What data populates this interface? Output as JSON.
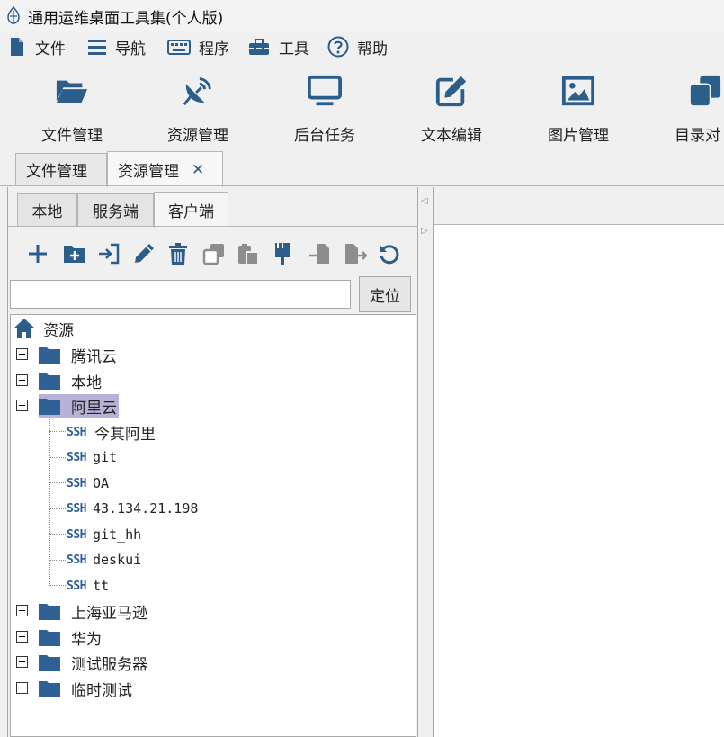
{
  "window": {
    "title": "通用运维桌面工具集(个人版)"
  },
  "menu": [
    {
      "label": "文件",
      "icon": "file-icon"
    },
    {
      "label": "导航",
      "icon": "menu-icon"
    },
    {
      "label": "程序",
      "icon": "keyboard-icon"
    },
    {
      "label": "工具",
      "icon": "toolbox-icon"
    },
    {
      "label": "帮助",
      "icon": "help-icon"
    }
  ],
  "toolbar": [
    {
      "label": "文件管理",
      "icon": "folder-open-icon"
    },
    {
      "label": "资源管理",
      "icon": "satellite-dish-icon"
    },
    {
      "label": "后台任务",
      "icon": "monitor-icon"
    },
    {
      "label": "文本编辑",
      "icon": "edit-icon"
    },
    {
      "label": "图片管理",
      "icon": "image-icon"
    },
    {
      "label": "目录对",
      "icon": "copy-icon"
    }
  ],
  "main_tabs": [
    {
      "label": "文件管理",
      "active": false
    },
    {
      "label": "资源管理",
      "active": true,
      "closable": true
    }
  ],
  "close_glyph": "✕",
  "sub_tabs": [
    {
      "label": "本地",
      "active": false
    },
    {
      "label": "服务端",
      "active": false
    },
    {
      "label": "客户端",
      "active": true
    }
  ],
  "actions": [
    "add-icon",
    "new-folder-icon",
    "login-icon",
    "pencil-icon",
    "trash-icon",
    "copy-icon",
    "paste-icon",
    "brush-icon",
    "import-icon",
    "export-icon",
    "refresh-icon"
  ],
  "search": {
    "value": "",
    "button": "定位"
  },
  "tree": {
    "root": "资源",
    "groups": [
      {
        "label": "腾讯云",
        "expanded": false
      },
      {
        "label": "本地",
        "expanded": false
      },
      {
        "label": "阿里云",
        "expanded": true,
        "selected": true,
        "children": [
          {
            "tag": "SSH",
            "name": "今其阿里"
          },
          {
            "tag": "SSH",
            "name": "git"
          },
          {
            "tag": "SSH",
            "name": "OA"
          },
          {
            "tag": "SSH",
            "name": "43.134.21.198"
          },
          {
            "tag": "SSH",
            "name": "git_hh"
          },
          {
            "tag": "SSH",
            "name": "deskui"
          },
          {
            "tag": "SSH",
            "name": "tt"
          }
        ]
      },
      {
        "label": "上海亚马逊",
        "expanded": false
      },
      {
        "label": "华为",
        "expanded": false
      },
      {
        "label": "测试服务器",
        "expanded": false
      },
      {
        "label": "临时测试",
        "expanded": false
      }
    ]
  },
  "splitter": {
    "left_arrow": "◁",
    "right_arrow": "▷"
  },
  "colors": {
    "accent": "#2c5e8c",
    "selection": "#b8b2d8",
    "folder": "#2f6096"
  }
}
